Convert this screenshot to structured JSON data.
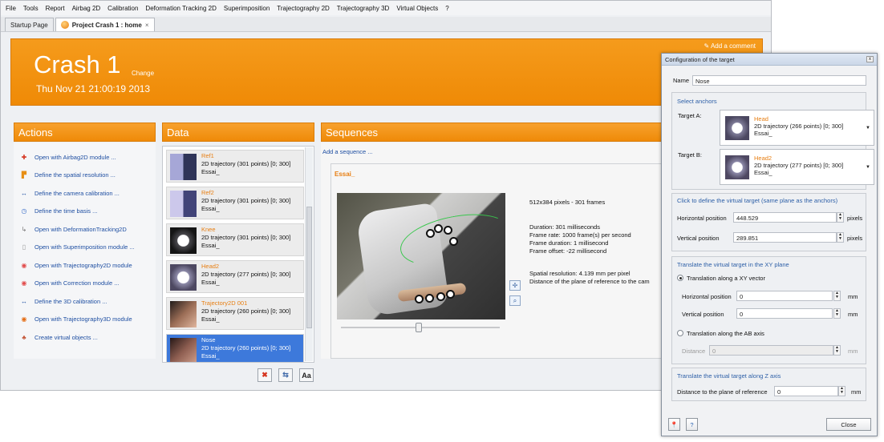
{
  "menu": [
    "File",
    "Tools",
    "Report",
    "Airbag 2D",
    "Calibration",
    "Deformation Tracking 2D",
    "Superimposition",
    "Trajectography 2D",
    "Trajectography 3D",
    "Virtual Objects",
    "?"
  ],
  "tabs": [
    {
      "label": "Startup Page"
    },
    {
      "label": "Project Crash 1 : home",
      "close": "×"
    }
  ],
  "header": {
    "title": "Crash 1",
    "change": "Change",
    "date": "Thu Nov 21 21:00:19 2013",
    "add_comment": "Add a comment"
  },
  "actions": {
    "title": "Actions",
    "items": [
      {
        "label": "Open with Airbag2D module ...",
        "icon": "pin-icon",
        "color": "#d4321d"
      },
      {
        "label": "Define the spatial resolution ...",
        "icon": "ruler-icon",
        "color": "#e78f16"
      },
      {
        "label": "Define the camera calibration ...",
        "icon": "arrows-icon",
        "color": "#333"
      },
      {
        "label": "Define the time basis ...",
        "icon": "clock-icon",
        "color": "#3b6fc8"
      },
      {
        "label": "Open with DeformationTracking2D",
        "icon": "curve-icon",
        "color": "#777"
      },
      {
        "label": "Open with Superimposition module ...",
        "icon": "layers-icon",
        "color": "#999"
      },
      {
        "label": "Open with Trajectography2D module",
        "icon": "target-icon",
        "color": "#e14b4b"
      },
      {
        "label": "Open with Correction module ...",
        "icon": "target-icon",
        "color": "#e14b4b"
      },
      {
        "label": "Define the 3D calibration ...",
        "icon": "arrows-icon",
        "color": "#333"
      },
      {
        "label": "Open with Trajectography3D module",
        "icon": "target3d-icon",
        "color": "#e46b12"
      },
      {
        "label": "Create virtual objects ...",
        "icon": "objects-icon",
        "color": "#c4583a"
      }
    ]
  },
  "data": {
    "title": "Data",
    "items": [
      {
        "name": "Ref1",
        "desc": "2D trajectory (301 points) [0; 300]",
        "owner": "Essai_",
        "thumb": "checker"
      },
      {
        "name": "Ref2",
        "desc": "2D trajectory (301 points) [0; 300]",
        "owner": "Essai_",
        "thumb": "checker"
      },
      {
        "name": "Knee",
        "desc": "2D trajectory (301 points) [0; 300]",
        "owner": "Essai_",
        "thumb": "ring"
      },
      {
        "name": "Head2",
        "desc": "2D trajectory (277 points) [0; 300]",
        "owner": "Essai_",
        "thumb": "ring"
      },
      {
        "name": "Trajectory2D 001",
        "desc": "2D trajectory (260 points) [0; 300]",
        "owner": "Essai_",
        "thumb": "skin"
      },
      {
        "name": "Nose",
        "desc": "2D trajectory (260 points) [0; 300]",
        "owner": "Essai_",
        "thumb": "skin",
        "selected": true
      }
    ],
    "bottom_buttons": [
      "✖",
      "⇆",
      "Aa"
    ]
  },
  "sequences": {
    "title": "Sequences",
    "add": "Add a sequence ...",
    "card_title": "Essai_",
    "resolution": "512x384 pixels - 301 frames",
    "duration": "Duration: 301 milliseconds",
    "frame_rate": "Frame rate: 1000 frame(s) per second",
    "frame_duration": "Frame duration: 1 millisecond",
    "frame_offset": "Frame offset: -22 millisecond",
    "spatial": "Spatial resolution: 4.139 mm per pixel",
    "distance": "Distance of the plane of reference to the cam"
  },
  "dialog": {
    "title": "Configuration of the target",
    "close_x": "x",
    "name_label": "Name",
    "name_value": "Nose",
    "select_anchors": "Select anchors",
    "target_a_label": "Target A:",
    "target_a": {
      "name": "Head",
      "desc": "2D trajectory (266 points) [0; 300]",
      "owner": "Essai_"
    },
    "target_b_label": "Target B:",
    "target_b": {
      "name": "Head2",
      "desc": "2D trajectory (277 points) [0; 300]",
      "owner": "Essai_"
    },
    "define_virtual": "Click to define the virtual target (same plane as the anchors)",
    "horizontal_label": "Horizontal position",
    "horizontal_value": "448.529",
    "vertical_label": "Vertical position",
    "vertical_value": "289.851",
    "pixels": "pixels",
    "translate_xy_title": "Translate the virtual target in the XY plane",
    "translation_xy": "Translation along a XY vector",
    "translation_h_label": "Horizontal position",
    "translation_h_value": "0",
    "translation_v_label": "Vertical position",
    "translation_v_value": "0",
    "mm": "mm",
    "translation_ab": "Translation along the AB axis",
    "distance_label": "Distance",
    "distance_value": "0",
    "translate_z_title": "Translate the virtual target along Z axis",
    "plane_label": "Distance to the plane of reference",
    "plane_value": "0",
    "close_button": "Close"
  },
  "colors": {
    "orange": "#ef8a08",
    "link": "#1f4fa2",
    "selection": "#3d79db"
  }
}
